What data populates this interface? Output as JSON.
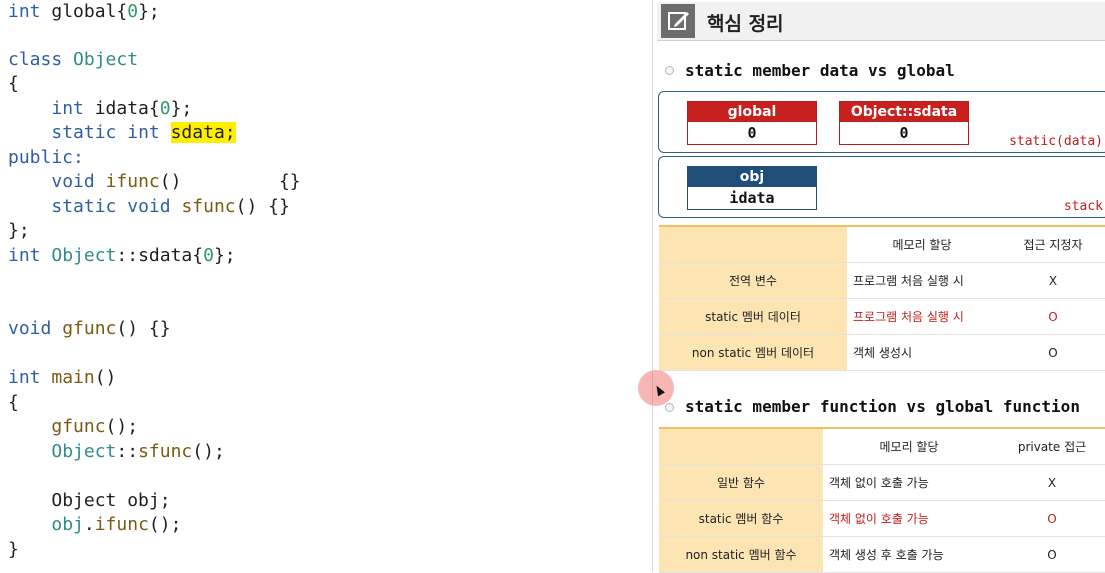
{
  "code": {
    "l1": {
      "kw": "int",
      "rest": " global{",
      "num": "0",
      "end": "};"
    },
    "l3": {
      "kw": "class",
      "ty": "Object"
    },
    "l4": {
      "t": "{"
    },
    "l5": {
      "kw": "int",
      "rest": " idata{",
      "num": "0",
      "end": "};"
    },
    "l6": {
      "kw1": "static",
      "kw2": "int",
      "hl": "sdata;"
    },
    "l7": {
      "kw": "public:"
    },
    "l8": {
      "kw": "void",
      "fn": "ifunc",
      "rest": "()         {}"
    },
    "l9": {
      "kw1": "static",
      "kw2": "void",
      "fn": "sfunc",
      "rest": "() {}"
    },
    "l10": {
      "t": "};"
    },
    "l11": {
      "kw": "int",
      "ty": "Object",
      "rest": "::sdata{",
      "num": "0",
      "end": "};"
    },
    "l14": {
      "kw": "void",
      "fn": "gfunc",
      "rest": "() {}"
    },
    "l16": {
      "kw": "int",
      "fn": "main",
      "rest": "()"
    },
    "l17": {
      "t": "{"
    },
    "l18": {
      "fn": "gfunc",
      "rest": "();"
    },
    "l19": {
      "ty": "Object",
      "mid": "::",
      "fn": "sfunc",
      "rest": "();"
    },
    "l21": {
      "t": "Object obj;"
    },
    "l22": {
      "obj": "obj",
      "mid": ".",
      "fn": "ifunc",
      "rest": "();"
    },
    "l23": {
      "t": "}"
    }
  },
  "notes": {
    "title": "핵심 정리",
    "section1": "static member data vs global",
    "section2": "static member function vs global function",
    "global_var": {
      "name": "global",
      "value": "0"
    },
    "sdata_var": {
      "name": "Object::sdata",
      "value": "0"
    },
    "static_area": "static(data)",
    "obj_var": {
      "name": "obj",
      "value": "idata"
    },
    "stack_area": "stack",
    "table1": {
      "header": [
        "",
        "메모리 할당",
        "접근 지정자"
      ],
      "rows": [
        [
          "전역 변수",
          "프로그램 처음 실행 시",
          "X"
        ],
        [
          "static 멤버 데이터",
          "프로그램 처음 실행 시",
          "O"
        ],
        [
          "non static 멤버 데이터",
          "객체 생성시",
          "O"
        ]
      ]
    },
    "table2": {
      "header": [
        "",
        "메모리 할당",
        "private 접근"
      ],
      "rows": [
        [
          "일반 함수",
          "객체 없이 호출 가능",
          "X"
        ],
        [
          "static 멤버 함수",
          "객체 없이 호출 가능",
          "O"
        ],
        [
          "non static 멤버 함수",
          "객체 생성 후 호출 가능",
          "O"
        ]
      ]
    }
  },
  "colors": {
    "accent_red": "#c8201f",
    "accent_blue": "#1f4e79",
    "highlight": "#ffee00"
  }
}
